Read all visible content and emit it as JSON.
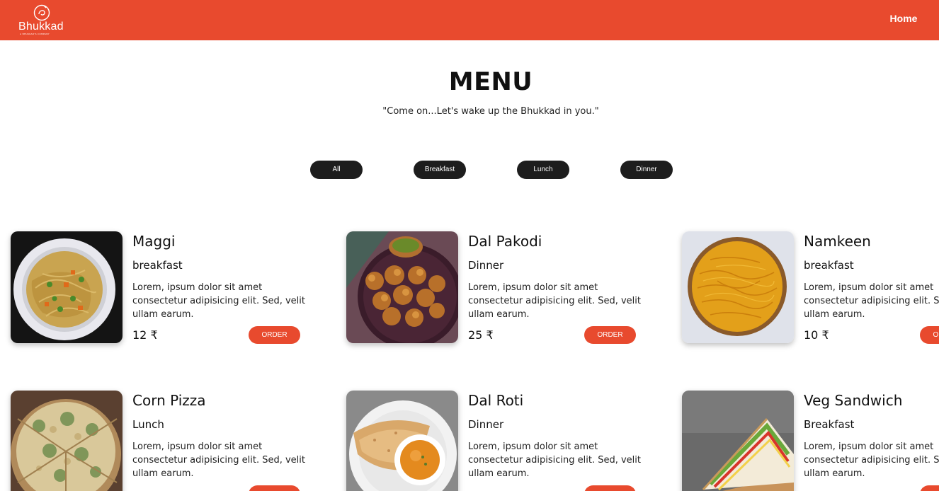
{
  "navbar": {
    "brand": "Bhukkad",
    "brand_tagline": "A BHUKKAD'S COMPANY",
    "home_link": "Home",
    "bg_color": "#e84a2e"
  },
  "hero": {
    "title": "MENU",
    "subtitle": "\"Come on...Let's wake up the Bhukkad in you.\""
  },
  "filters": [
    "All",
    "Breakfast",
    "Lunch",
    "Dinner"
  ],
  "order_label": "ORDER",
  "items": [
    {
      "name": "Maggi",
      "category": "breakfast",
      "description": "Lorem, ipsum dolor sit amet consectetur adipisicing elit. Sed, velit ullam earum.",
      "price": "12 ₹",
      "image": "noodles-plate"
    },
    {
      "name": "Dal Pakodi",
      "category": "Dinner",
      "description": "Lorem, ipsum dolor sit amet consectetur adipisicing elit. Sed, velit ullam earum.",
      "price": "25 ₹",
      "image": "fritters-plate"
    },
    {
      "name": "Namkeen",
      "category": "breakfast",
      "description": "Lorem, ipsum dolor sit amet consectetur adipisicing elit. Sed, velit ullam earum.",
      "price": "10 ₹",
      "image": "sev-bowl"
    },
    {
      "name": "Corn Pizza",
      "category": "Lunch",
      "description": "Lorem, ipsum dolor sit amet consectetur adipisicing elit. Sed, velit ullam earum.",
      "price": "",
      "image": "pizza"
    },
    {
      "name": "Dal Roti",
      "category": "Dinner",
      "description": "Lorem, ipsum dolor sit amet consectetur adipisicing elit. Sed, velit ullam earum.",
      "price": "",
      "image": "roti-dal"
    },
    {
      "name": "Veg Sandwich",
      "category": "Breakfast",
      "description": "Lorem, ipsum dolor sit amet consectetur adipisicing elit. Sed, velit ullam earum.",
      "price": "",
      "image": "sandwich"
    }
  ]
}
